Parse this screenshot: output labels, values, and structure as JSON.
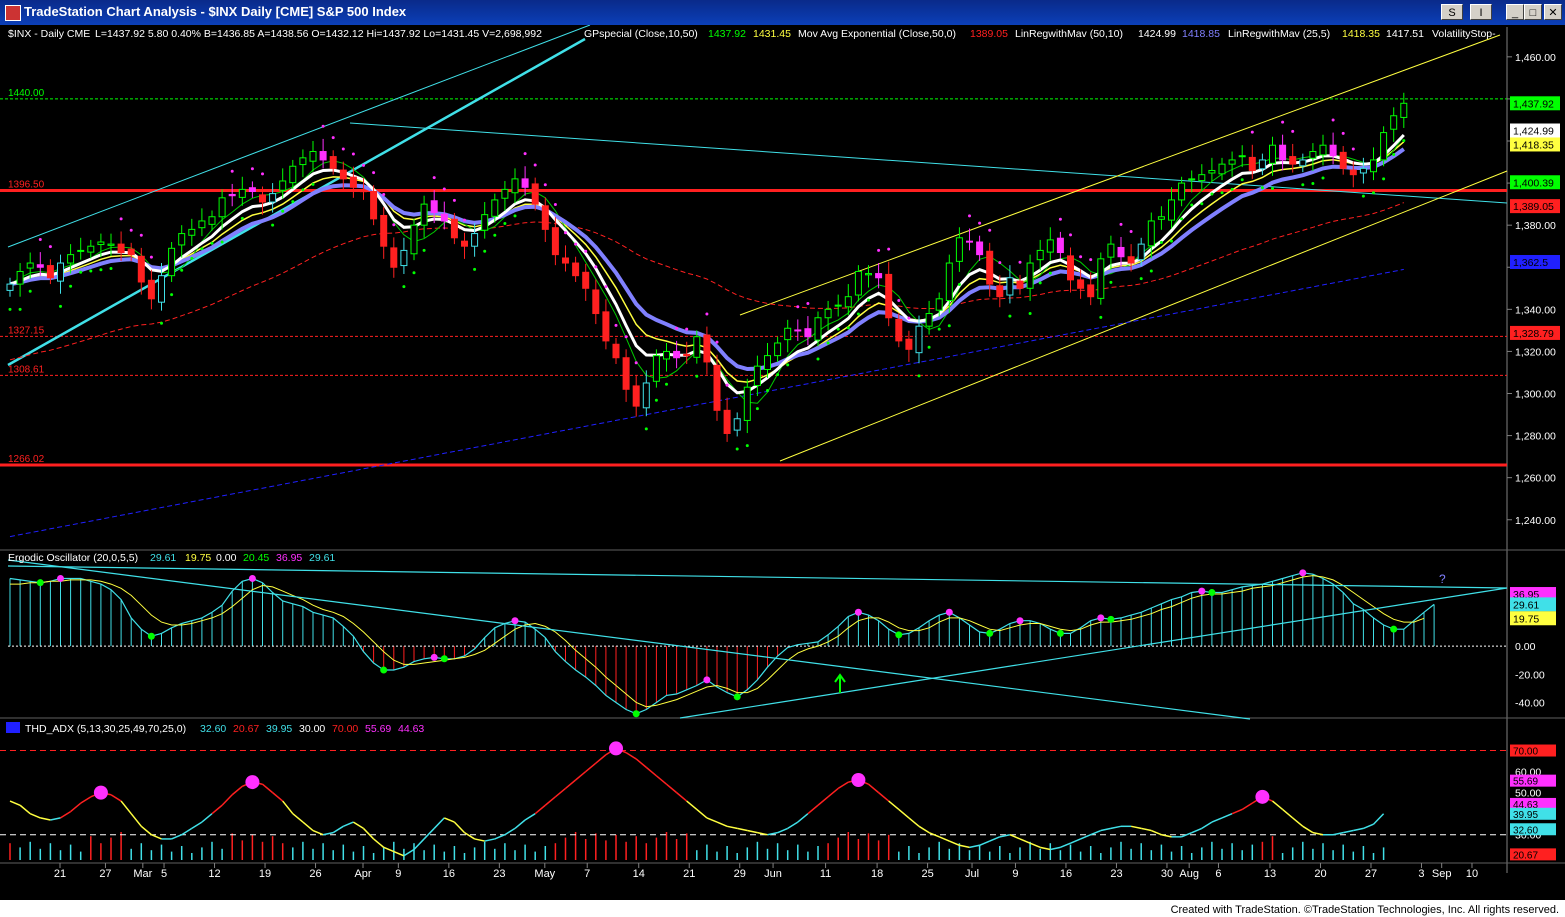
{
  "window": {
    "title": "TradeStation Chart Analysis - $INX Daily [CME] S&P 500 Index",
    "btn_s": "S",
    "btn_i": "I",
    "btn_min": "_",
    "btn_max": "□",
    "btn_close": "✕"
  },
  "colors": {
    "background": "#000000",
    "up_candle": "#00ff00",
    "down_candle": "#ff2020",
    "cyan": "#40e0e8",
    "magenta": "#ff30ff",
    "yellow": "#ffff40",
    "white": "#ffffff",
    "lavender": "#8080ff",
    "support_red": "#ff2020"
  },
  "price_header": {
    "symbol": "$INX - Daily  CME",
    "stats": "L=1437.92  5.80  0.40%   B=1436.85  A=1438.56  O=1432.12  Hi=1437.92  Lo=1431.45  V=2,698,992",
    "gp_label": "GPspecial (Close,10,50)",
    "gp_v1": "1437.92",
    "gp_v2": "1431.45",
    "ema_label": "Mov Avg Exponential (Close,50,0)",
    "ema_v": "1389.05",
    "lr1_label": "LinRegwithMav (50,10)",
    "lr1_v1": "1424.99",
    "lr1_v2": "1418.85",
    "lr2_label": "LinRegwithMav (25,5)",
    "lr2_v1": "1418.35",
    "lr2_v2": "1417.51",
    "vstop_label": "VolatilityStop-"
  },
  "ergodic_header": {
    "label": "Ergodic Oscillator (20,0,5,5)",
    "v1": "29.61",
    "v2": "19.75",
    "v3": "0.00",
    "v4": "20.45",
    "v5": "36.95",
    "v6": "29.61"
  },
  "adx_header": {
    "label": "THD_ADX (5,13,30,25,49,70,25,0)",
    "v1": "32.60",
    "v2": "20.67",
    "v3": "39.95",
    "v4": "30.00",
    "v5": "70.00",
    "v6": "55.69",
    "v7": "44.63"
  },
  "footer": "Created with TradeStation. ©TradeStation Technologies, Inc. All rights reserved.",
  "chart_data": [
    {
      "type": "candlestick",
      "panel": "price",
      "y_ticks": [
        1460,
        1440,
        1420,
        1400,
        1380,
        1360,
        1340,
        1320,
        1300,
        1280,
        1260,
        1240
      ],
      "y_tick_labels": [
        "1,460.00",
        "",
        "",
        "",
        "1,380.00",
        "",
        "1,340.00",
        "1,320.00",
        "1,300.00",
        "1,280.00",
        "1,260.00",
        "1,240.00"
      ],
      "ylim": [
        1228,
        1468
      ],
      "x_labels": [
        {
          "d": 0.0,
          "t": "21"
        },
        {
          "d": 4.5,
          "t": "27"
        },
        {
          "d": 8.2,
          "t": "Mar"
        },
        {
          "d": 10.3,
          "t": "5"
        },
        {
          "d": 15.3,
          "t": "12"
        },
        {
          "d": 20.3,
          "t": "19"
        },
        {
          "d": 25.3,
          "t": "26"
        },
        {
          "d": 30.0,
          "t": "Apr"
        },
        {
          "d": 33.5,
          "t": "9"
        },
        {
          "d": 38.5,
          "t": "16"
        },
        {
          "d": 43.5,
          "t": "23"
        },
        {
          "d": 48.0,
          "t": "May"
        },
        {
          "d": 52.2,
          "t": "7"
        },
        {
          "d": 57.3,
          "t": "14"
        },
        {
          "d": 62.3,
          "t": "21"
        },
        {
          "d": 67.3,
          "t": "29"
        },
        {
          "d": 70.6,
          "t": "Jun"
        },
        {
          "d": 75.8,
          "t": "11"
        },
        {
          "d": 80.9,
          "t": "18"
        },
        {
          "d": 85.9,
          "t": "25"
        },
        {
          "d": 90.3,
          "t": "Jul"
        },
        {
          "d": 94.6,
          "t": "9"
        },
        {
          "d": 99.6,
          "t": "16"
        },
        {
          "d": 104.6,
          "t": "23"
        },
        {
          "d": 109.6,
          "t": "30"
        },
        {
          "d": 111.8,
          "t": "Aug"
        },
        {
          "d": 114.7,
          "t": "6"
        },
        {
          "d": 119.8,
          "t": "13"
        },
        {
          "d": 124.8,
          "t": "20"
        },
        {
          "d": 129.8,
          "t": "27"
        },
        {
          "d": 134.8,
          "t": "3"
        },
        {
          "d": 136.8,
          "t": "Sep"
        },
        {
          "d": 139.8,
          "t": "10"
        }
      ],
      "closes": [
        1352,
        1358,
        1362,
        1360,
        1355,
        1362,
        1366,
        1368,
        1370,
        1372,
        1371,
        1367,
        1366,
        1353,
        1345,
        1356,
        1369,
        1376,
        1378,
        1382,
        1384,
        1393,
        1394,
        1397,
        1396,
        1391,
        1395,
        1401,
        1408,
        1412,
        1415,
        1411,
        1407,
        1402,
        1398,
        1396,
        1383,
        1370,
        1360,
        1368,
        1380,
        1390,
        1386,
        1382,
        1374,
        1370,
        1376,
        1385,
        1392,
        1397,
        1402,
        1398,
        1390,
        1378,
        1366,
        1362,
        1356,
        1350,
        1338,
        1325,
        1317,
        1302,
        1294,
        1305,
        1318,
        1320,
        1317,
        1318,
        1327,
        1315,
        1292,
        1281,
        1288,
        1303,
        1313,
        1318,
        1324,
        1331,
        1330,
        1327,
        1336,
        1340,
        1342,
        1346,
        1358,
        1357,
        1355,
        1336,
        1325,
        1321,
        1332,
        1338,
        1345,
        1362,
        1374,
        1372,
        1366,
        1352,
        1346,
        1355,
        1350,
        1362,
        1368,
        1373,
        1367,
        1354,
        1350,
        1346,
        1364,
        1371,
        1365,
        1362,
        1371,
        1382,
        1384,
        1392,
        1400,
        1402,
        1404,
        1406,
        1409,
        1411,
        1413,
        1406,
        1411,
        1418,
        1411,
        1409,
        1411,
        1415,
        1418,
        1413,
        1407,
        1404,
        1407,
        1411,
        1424,
        1432,
        1437.92
      ],
      "hlines": [
        {
          "y": 1440.0,
          "label": "1440.00",
          "color": "#00ff00"
        },
        {
          "y": 1396.5,
          "label": "1396.50",
          "color": "#ff2020"
        },
        {
          "y": 1327.15,
          "label": "1327.15",
          "color": "#ff2020"
        },
        {
          "y": 1308.61,
          "label": "1308.61",
          "color": "#ff2020"
        },
        {
          "y": 1266.02,
          "label": "1266.02",
          "color": "#ff2020"
        }
      ],
      "right_tags": [
        {
          "y": 1437.92,
          "t": "1,437.92",
          "bg": "#00ff00",
          "fg": "#000"
        },
        {
          "y": 1424.99,
          "t": "1,424.99",
          "bg": "#ffffff",
          "fg": "#000"
        },
        {
          "y": 1418.35,
          "t": "1,418.35",
          "bg": "#ffff40",
          "fg": "#000"
        },
        {
          "y": 1400.39,
          "t": "1,400.39",
          "bg": "#00ff00",
          "fg": "#000"
        },
        {
          "y": 1389.05,
          "t": "1,389.05",
          "bg": "#ff2020",
          "fg": "#000"
        },
        {
          "y": 1362.5,
          "t": "1,362.5",
          "bg": "#2020ff",
          "fg": "#000"
        },
        {
          "y": 1328.79,
          "t": "1,328.79",
          "bg": "#ff2020",
          "fg": "#000"
        }
      ]
    },
    {
      "type": "line",
      "panel": "ergodic",
      "y_ticks": [
        -40,
        -20,
        0
      ],
      "y_tick_labels": [
        "-40.00",
        "-20.00",
        "0.00"
      ],
      "ylim": [
        -56,
        54
      ],
      "values": [
        48,
        47,
        46,
        45,
        46,
        48,
        48,
        48,
        46,
        44,
        40,
        33,
        20,
        12,
        7,
        9,
        13,
        16,
        18,
        20,
        24,
        29,
        39,
        46,
        48,
        45,
        38,
        32,
        30,
        28,
        24,
        22,
        20,
        14,
        7,
        -4,
        -12,
        -17,
        -17,
        -15,
        -11,
        -9,
        -8,
        -9,
        -9,
        -7,
        -2,
        6,
        13,
        16,
        18,
        17,
        12,
        6,
        -4,
        -11,
        -17,
        -22,
        -28,
        -35,
        -40,
        -45,
        -48,
        -45,
        -40,
        -35,
        -34,
        -31,
        -28,
        -24,
        -29,
        -33,
        -36,
        -31,
        -24,
        -15,
        -7,
        -1,
        1,
        2,
        3,
        8,
        14,
        21,
        24,
        22,
        18,
        12,
        8,
        9,
        13,
        18,
        22,
        24,
        20,
        15,
        10,
        9,
        12,
        16,
        18,
        18,
        16,
        12,
        9,
        9,
        13,
        18,
        20,
        19,
        20,
        22,
        24,
        27,
        30,
        33,
        35,
        38,
        39,
        38,
        38,
        40,
        42,
        43,
        44,
        46,
        48,
        50,
        52,
        51,
        48,
        44,
        38,
        30,
        26,
        20,
        15,
        12,
        12,
        18,
        24,
        29.61
      ],
      "signal": [
        44,
        44,
        45,
        45,
        46,
        46,
        47,
        47,
        47,
        46,
        44,
        41,
        36,
        29,
        22,
        17,
        15,
        15,
        16,
        18,
        20,
        23,
        28,
        34,
        40,
        43,
        42,
        39,
        36,
        33,
        29,
        26,
        24,
        21,
        16,
        10,
        3,
        -4,
        -10,
        -13,
        -13,
        -12,
        -11,
        -10,
        -9,
        -8,
        -6,
        -3,
        2,
        7,
        12,
        15,
        16,
        14,
        10,
        4,
        -3,
        -9,
        -15,
        -22,
        -28,
        -34,
        -40,
        -43,
        -42,
        -40,
        -38,
        -35,
        -32,
        -29,
        -28,
        -30,
        -33,
        -33,
        -30,
        -24,
        -17,
        -10,
        -5,
        -2,
        0,
        3,
        7,
        13,
        18,
        20,
        20,
        17,
        13,
        11,
        11,
        13,
        17,
        20,
        20,
        18,
        15,
        12,
        11,
        13,
        15,
        16,
        16,
        14,
        12,
        11,
        12,
        15,
        17,
        17,
        18,
        19,
        21,
        23,
        26,
        28,
        31,
        34,
        36,
        37,
        37,
        38,
        39,
        41,
        42,
        43,
        45,
        47,
        49,
        50,
        49,
        47,
        43,
        38,
        33,
        28,
        23,
        19,
        17,
        17,
        19.75
      ],
      "annotation": "?"
    },
    {
      "type": "line",
      "panel": "adx",
      "y_ticks": [
        70,
        60,
        50,
        40,
        30
      ],
      "y_tick_labels": [
        "70.00",
        "60.00",
        "50.00",
        "40.00",
        "30.00"
      ],
      "ylim": [
        18,
        75
      ],
      "values": [
        46,
        44,
        40,
        38,
        37,
        38,
        41,
        45,
        48,
        50,
        49,
        46,
        40,
        34,
        30,
        28,
        28,
        30,
        33,
        36,
        40,
        44,
        49,
        53,
        55,
        54,
        50,
        46,
        40,
        36,
        32,
        30,
        31,
        34,
        36,
        33,
        28,
        24,
        22,
        20,
        23,
        28,
        33,
        38,
        36,
        31,
        28,
        27,
        28,
        30,
        33,
        37,
        40,
        44,
        48,
        52,
        56,
        60,
        64,
        68,
        71,
        69,
        66,
        62,
        58,
        54,
        50,
        46,
        42,
        38,
        36,
        34,
        33,
        32,
        31,
        30,
        31,
        33,
        36,
        40,
        44,
        48,
        52,
        55,
        56,
        54,
        50,
        46,
        42,
        38,
        34,
        31,
        29,
        27,
        25,
        24,
        25,
        27,
        29,
        30,
        28,
        26,
        24,
        23,
        24,
        26,
        28,
        30,
        32,
        33,
        34,
        34,
        33,
        32,
        30,
        29,
        29,
        31,
        33,
        36,
        38,
        40,
        42,
        45,
        48,
        46,
        42,
        38,
        34,
        31,
        30,
        30,
        31,
        32,
        33,
        35,
        39.95
      ]
    }
  ]
}
